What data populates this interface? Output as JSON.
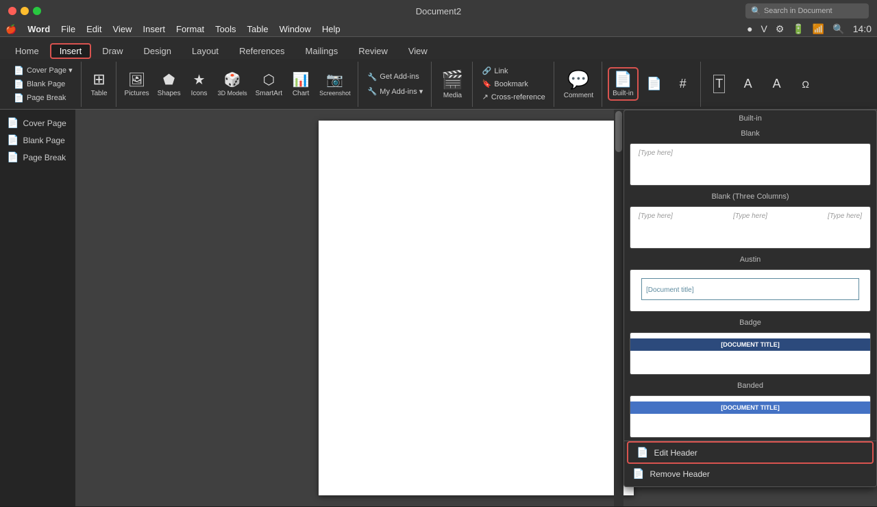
{
  "titlebar": {
    "document_title": "Document2",
    "search_placeholder": "Search in Document"
  },
  "mac_menu": {
    "apple": "🍎",
    "items": [
      "Word",
      "File",
      "Edit",
      "View",
      "Insert",
      "Format",
      "Tools",
      "Table",
      "Window",
      "Help"
    ]
  },
  "ribbon": {
    "tabs": [
      "Home",
      "Insert",
      "Draw",
      "Design",
      "Layout",
      "References",
      "Mailings",
      "Review",
      "View"
    ],
    "active_tab": "Insert",
    "groups": [
      {
        "name": "pages",
        "items": [
          "Cover Page",
          "Blank Page",
          "Page Break"
        ]
      },
      {
        "name": "table",
        "label": "Table"
      },
      {
        "name": "illustrations",
        "items": [
          "Pictures",
          "Shapes",
          "Icons",
          "3D Models",
          "SmartArt",
          "Chart",
          "Screenshot"
        ]
      },
      {
        "name": "addins",
        "items": [
          "Get Add-ins",
          "My Add-ins"
        ]
      },
      {
        "name": "media",
        "label": "Media"
      },
      {
        "name": "links",
        "items": [
          "Link",
          "Bookmark",
          "Cross-reference"
        ]
      },
      {
        "name": "comments",
        "label": "Comment"
      },
      {
        "name": "header_footer",
        "label": "Built-in",
        "highlighted": true
      },
      {
        "name": "more_group",
        "items": [
          "page_number",
          "text_box",
          "font_color",
          "font_size",
          "more"
        ]
      }
    ]
  },
  "header_dropdown": {
    "section_label": "Built-in",
    "options": [
      {
        "name": "Blank",
        "type": "blank",
        "placeholder": "[Type here]"
      },
      {
        "name": "Blank (Three Columns)",
        "type": "three_col",
        "placeholders": [
          "[Type here]",
          "[Type here]",
          "[Type here]"
        ]
      },
      {
        "name": "Austin",
        "type": "austin",
        "placeholder": "[Document title]"
      },
      {
        "name": "Badge",
        "type": "badge",
        "text": "[DOCUMENT TITLE]"
      },
      {
        "name": "Banded",
        "type": "banded",
        "text": "[DOCUMENT TITLE]"
      }
    ],
    "footer_actions": [
      {
        "id": "edit_header",
        "label": "Edit Header",
        "highlighted": true
      },
      {
        "id": "remove_header",
        "label": "Remove Header",
        "highlighted": false
      }
    ]
  },
  "sidebar": {
    "items": [
      {
        "id": "cover_page",
        "label": "Cover Page",
        "icon": "📄"
      },
      {
        "id": "blank_page",
        "label": "Blank Page",
        "icon": "📄"
      },
      {
        "id": "page_break",
        "label": "Page Break",
        "icon": "📄"
      }
    ]
  },
  "icons": {
    "table": "⊞",
    "pictures": "🖼",
    "shapes": "⬟",
    "icons_btn": "★",
    "3d_models": "🎲",
    "smartart": "⬡",
    "chart": "📊",
    "screenshot": "📷",
    "get_addins": "🔧",
    "my_addins": "🔧",
    "media": "🎬",
    "link": "🔗",
    "bookmark": "🔖",
    "cross_ref": "↗",
    "comment": "💬",
    "header": "📄",
    "page_number": "🔢",
    "text_box": "T",
    "search": "🔍"
  }
}
